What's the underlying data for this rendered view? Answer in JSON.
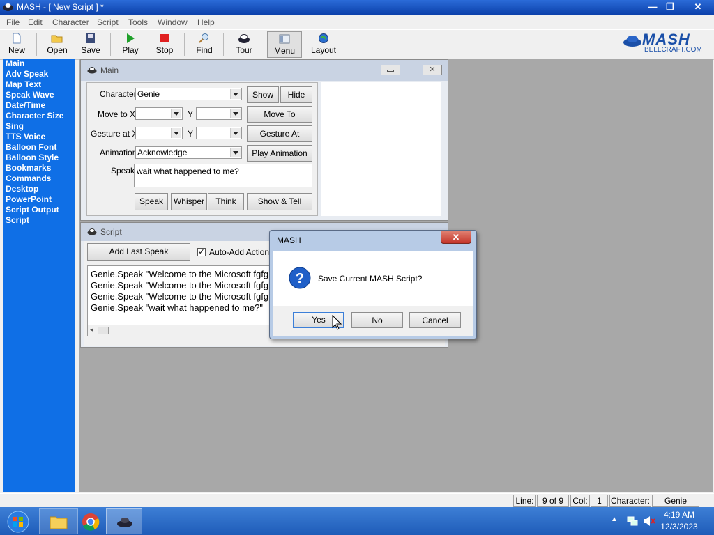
{
  "window": {
    "title": "MASH - [ New Script ] *",
    "controls": [
      "—",
      "❐",
      "✕"
    ]
  },
  "menu": [
    "File",
    "Edit",
    "Character",
    "Script",
    "Tools",
    "Window",
    "Help"
  ],
  "toolbar": [
    {
      "label": "New",
      "icon": "new-doc-icon"
    },
    {
      "label": "Open",
      "icon": "folder-open-icon"
    },
    {
      "label": "Save",
      "icon": "save-disk-icon"
    },
    {
      "label": "Play",
      "icon": "play-icon"
    },
    {
      "label": "Stop",
      "icon": "stop-icon"
    },
    {
      "label": "Find",
      "icon": "find-icon"
    },
    {
      "label": "Tour",
      "icon": "tour-icon"
    },
    {
      "label": "Menu",
      "icon": "menu-icon"
    },
    {
      "label": "Layout",
      "icon": "layout-globe-icon"
    }
  ],
  "logo": {
    "text": "MASH",
    "sub": "BELLCRAFT.COM"
  },
  "nav": [
    "Main",
    "Adv Speak",
    "Map Text",
    "Speak Wave",
    "Date/Time",
    "Character Size",
    "Sing",
    "TTS Voice",
    "Balloon Font",
    "Balloon Style",
    "Bookmarks",
    "Commands",
    "Desktop",
    "PowerPoint",
    "Script Output",
    "Script"
  ],
  "main_window": {
    "title": "Main",
    "character_label": "Character",
    "character_value": "Genie",
    "show": "Show",
    "hide": "Hide",
    "move_label": "Move to X",
    "y_label": "Y",
    "move_to": "Move To",
    "gesture_label": "Gesture at X",
    "gesture_at": "Gesture At",
    "animation_label": "Animation",
    "animation_value": "Acknowledge",
    "play_animation": "Play Animation",
    "speak_label": "Speak",
    "speak_value": "wait what happened to me?",
    "buttons": [
      "Speak",
      "Whisper",
      "Think",
      "Show & Tell"
    ]
  },
  "script_window": {
    "title": "Script",
    "add_last_speak": "Add Last Speak",
    "auto_add": "Auto-Add Actions",
    "lines": [
      "Genie.Speak \"Welcome to the Microsoft fgfg",
      "Genie.Speak \"Welcome to the Microsoft fgfg",
      "Genie.Speak \"Welcome to the Microsoft fgfg",
      "Genie.Speak \"wait what happened to me?\""
    ]
  },
  "dialog": {
    "title": "MASH",
    "close": "✕",
    "message": "Save Current MASH Script?",
    "icon": "question-icon",
    "yes": "Yes",
    "no": "No",
    "cancel": "Cancel"
  },
  "status": {
    "line_label": "Line:",
    "line_value": "9 of 9",
    "col_label": "Col:",
    "col_value": "1",
    "char_label": "Character:",
    "char_value": "Genie"
  },
  "taskbar": {
    "time": "4:19 AM",
    "date": "12/3/2023"
  },
  "colors": {
    "nav_bg": "#0f6fe6",
    "titlebar": "#0a3ea8",
    "mdi_bg": "#a8a8a8"
  }
}
